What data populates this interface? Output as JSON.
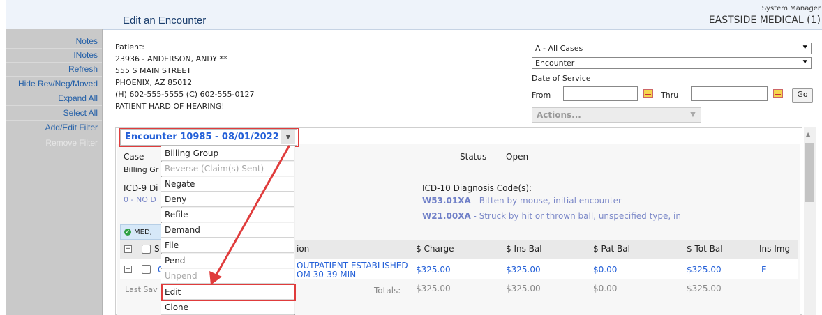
{
  "header": {
    "title": "Edit an Encounter",
    "user_role": "System Manager",
    "practice": "EASTSIDE MEDICAL (1)"
  },
  "sidebar": {
    "items": [
      {
        "label": "Notes",
        "enabled": true
      },
      {
        "label": "INotes",
        "enabled": true
      },
      {
        "label": "Refresh",
        "enabled": true
      },
      {
        "label": "Hide Rev/Neg/Moved",
        "enabled": true
      },
      {
        "label": "Expand All",
        "enabled": true
      },
      {
        "label": "Select All",
        "enabled": true
      },
      {
        "label": "Add/Edit Filter",
        "enabled": true
      },
      {
        "label": "Remove Filter",
        "enabled": false
      }
    ]
  },
  "patient": {
    "label": "Patient:",
    "name_line": "23936 - ANDERSON, ANDY **",
    "address1": "555 S MAIN STREET",
    "address2": "PHOENIX, AZ 85012",
    "phones": "(H) 602-555-5555 (C) 602-555-0127",
    "note": "PATIENT HARD OF HEARING!"
  },
  "filters": {
    "cases": "A - All Cases",
    "type": "Encounter",
    "date_of_service_label": "Date of Service",
    "from_label": "From",
    "thru_label": "Thru",
    "from_value": "",
    "thru_value": "",
    "go_label": "Go",
    "actions_placeholder": "Actions..."
  },
  "encounter": {
    "selector_label": "Encounter 10985 - 08/01/2022",
    "case_label": "Case",
    "billing_group_label": "Billing Gr",
    "status_label": "Status",
    "status_value": "Open",
    "icd9_label": "ICD-9 Di",
    "icd9_value": "0 - NO D",
    "icd10_label": "ICD-10 Diagnosis Code(s):",
    "icd10_codes": [
      {
        "code": "W53.01XA",
        "desc": " - Bitten by mouse, initial encounter"
      },
      {
        "code": "W21.00XA",
        "desc": " - Struck by hit or thrown ball, unspecified type, in"
      }
    ],
    "insurance_badge": "MED,"
  },
  "table": {
    "headers": {
      "first_partial": "S",
      "desc_partial": "ion",
      "charge": "$ Charge",
      "ins_bal": "$ Ins Bal",
      "pat_bal": "$ Pat Bal",
      "tot_bal": "$ Tot Bal",
      "ins_img": "Ins Img"
    },
    "row": {
      "code_partial": "0",
      "desc_line1": "OUTPATIENT ESTABLISHED",
      "desc_line2": "OM 30-39 MIN",
      "charge": "$325.00",
      "ins_bal": "$325.00",
      "pat_bal": "$0.00",
      "tot_bal": "$325.00",
      "ins_img": "E"
    },
    "totals": {
      "last_saved_partial": "Last Sav",
      "label": "Totals:",
      "charge": "$325.00",
      "ins_bal": "$325.00",
      "pat_bal": "$0.00",
      "tot_bal": "$325.00"
    }
  },
  "menu": {
    "items": [
      {
        "label": "Billing Group",
        "enabled": true
      },
      {
        "label": "Reverse (Claim(s) Sent)",
        "enabled": false
      },
      {
        "label": "Negate",
        "enabled": true
      },
      {
        "label": "Deny",
        "enabled": true
      },
      {
        "label": "Refile",
        "enabled": true
      },
      {
        "label": "Demand",
        "enabled": true
      },
      {
        "label": "File",
        "enabled": true
      },
      {
        "label": "Pend",
        "enabled": true
      },
      {
        "label": "Unpend",
        "enabled": false
      },
      {
        "label": "Edit",
        "enabled": true,
        "highlighted": true
      },
      {
        "label": "Clone",
        "enabled": true
      }
    ]
  },
  "annotation_color": "#e03c3c"
}
